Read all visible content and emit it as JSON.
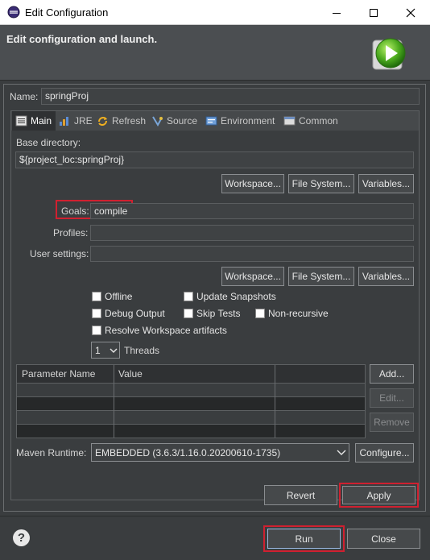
{
  "window": {
    "title": "Edit Configuration",
    "minimize": "—",
    "maximize": "☐",
    "close": "✕"
  },
  "header": {
    "title": "Edit configuration and launch."
  },
  "name_field": {
    "label": "Name:",
    "value": "springProj"
  },
  "tabs": [
    {
      "label": "Main",
      "icon": "main-tab-icon",
      "active": true
    },
    {
      "label": "JRE",
      "icon": "jre-icon"
    },
    {
      "label": "Refresh",
      "icon": "refresh-icon"
    },
    {
      "label": "Source",
      "icon": "source-icon"
    },
    {
      "label": "Environment",
      "icon": "environment-icon"
    },
    {
      "label": "Common",
      "icon": "common-icon"
    }
  ],
  "main": {
    "base_directory_label": "Base directory:",
    "base_directory_value": "${project_loc:springProj}",
    "buttons_row1": {
      "workspace": "Workspace...",
      "file_system": "File System...",
      "variables": "Variables..."
    },
    "goals_label": "Goals:",
    "goals_value": "compile",
    "profiles_label": "Profiles:",
    "profiles_value": "",
    "user_settings_label": "User settings:",
    "user_settings_value": "",
    "buttons_row2": {
      "workspace": "Workspace...",
      "file_system": "File System...",
      "variables": "Variables..."
    },
    "options": {
      "offline": "Offline",
      "update_snapshots": "Update Snapshots",
      "debug_output": "Debug Output",
      "skip_tests": "Skip Tests",
      "non_recursive": "Non-recursive",
      "resolve_workspace": "Resolve Workspace artifacts"
    },
    "threads_value": "1",
    "threads_label": "Threads",
    "table": {
      "columns": [
        "Parameter Name",
        "Value"
      ],
      "rows": []
    },
    "table_buttons": {
      "add": "Add...",
      "edit": "Edit...",
      "remove": "Remove"
    },
    "maven_runtime_label": "Maven Runtime:",
    "maven_runtime_value": "EMBEDDED (3.6.3/1.16.0.20200610-1735)",
    "configure": "Configure..."
  },
  "actions": {
    "revert": "Revert",
    "apply": "Apply",
    "run": "Run",
    "close": "Close"
  },
  "colors": {
    "highlight": "#d02030",
    "background": "#3a3d3f",
    "header": "#4b4e51"
  }
}
